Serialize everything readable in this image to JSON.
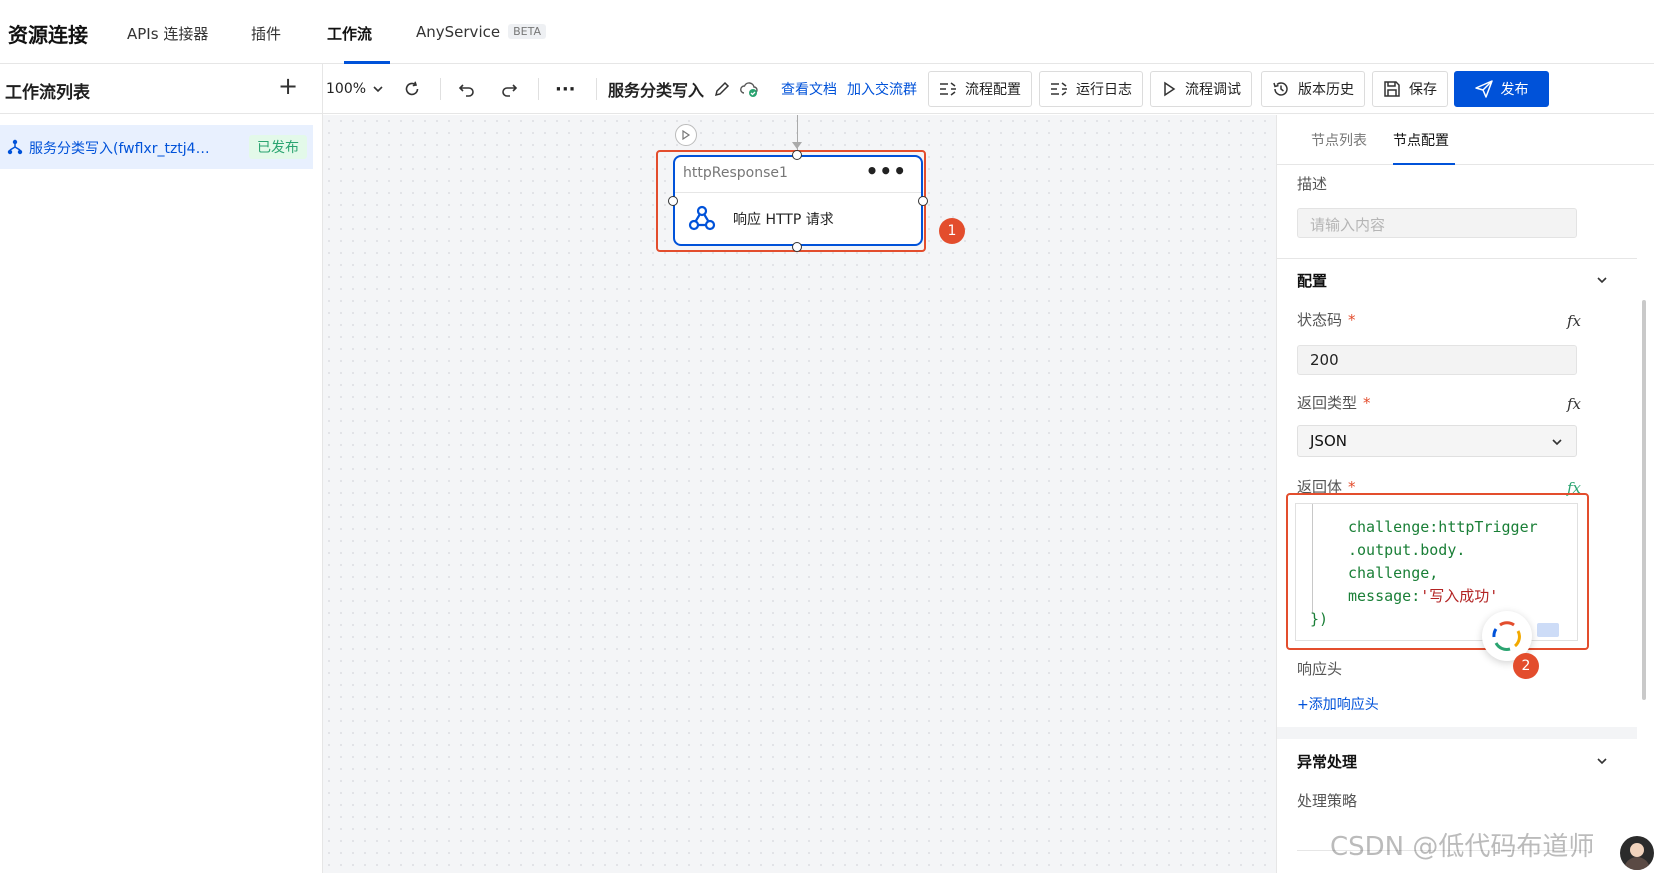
{
  "topnav": {
    "brand": "资源连接",
    "tabs": [
      {
        "label": "APIs 连接器"
      },
      {
        "label": "插件"
      },
      {
        "label": "工作流"
      },
      {
        "label": "AnyService",
        "badge": "BETA"
      }
    ],
    "active_tab": "工作流"
  },
  "sidebar": {
    "title": "工作流列表",
    "add_label": "+",
    "items": [
      {
        "name": "服务分类写入(fwflxr_tztj4…",
        "status": "已发布"
      }
    ]
  },
  "toolbar": {
    "zoom": "100%",
    "more": "···",
    "workflow_title": "服务分类写入",
    "docs_link": "查看文档",
    "join_group_link": "加入交流群",
    "buttons": {
      "flow_config": "流程配置",
      "run_log": "运行日志",
      "flow_debug": "流程调试",
      "version_history": "版本历史",
      "save": "保存",
      "publish": "发布"
    }
  },
  "canvas": {
    "node": {
      "id": "httpResponse1",
      "label": "响应 HTTP 请求",
      "more": "•••"
    },
    "markers": [
      "1",
      "2"
    ]
  },
  "panel": {
    "tabs": [
      "节点列表",
      "节点配置"
    ],
    "active_tab": "节点配置",
    "description": {
      "label": "描述",
      "placeholder": "请输入内容"
    },
    "config_section": "配置",
    "status_code": {
      "label": "状态码",
      "required": "*",
      "value": "200",
      "fx": "fx"
    },
    "return_type": {
      "label": "返回类型",
      "required": "*",
      "value": "JSON",
      "fx": "fx"
    },
    "return_body": {
      "label": "返回体",
      "required": "*",
      "fx": "fx",
      "code_lines": [
        {
          "key": "challenge:httpTrigger"
        },
        {
          "key": ".output.body."
        },
        {
          "key": "challenge,"
        },
        {
          "key": "message:",
          "str": "'写入成功'"
        },
        {
          "brace": "})"
        }
      ]
    },
    "response_headers": {
      "label": "响应头",
      "add_link": "+添加响应头"
    },
    "error_section": "异常处理",
    "strategy_label": "处理策略"
  },
  "watermark": "CSDN @低代码布道师",
  "colors": {
    "primary": "#0052d9",
    "highlight": "#e34d2d",
    "published_green": "#2ba471"
  }
}
